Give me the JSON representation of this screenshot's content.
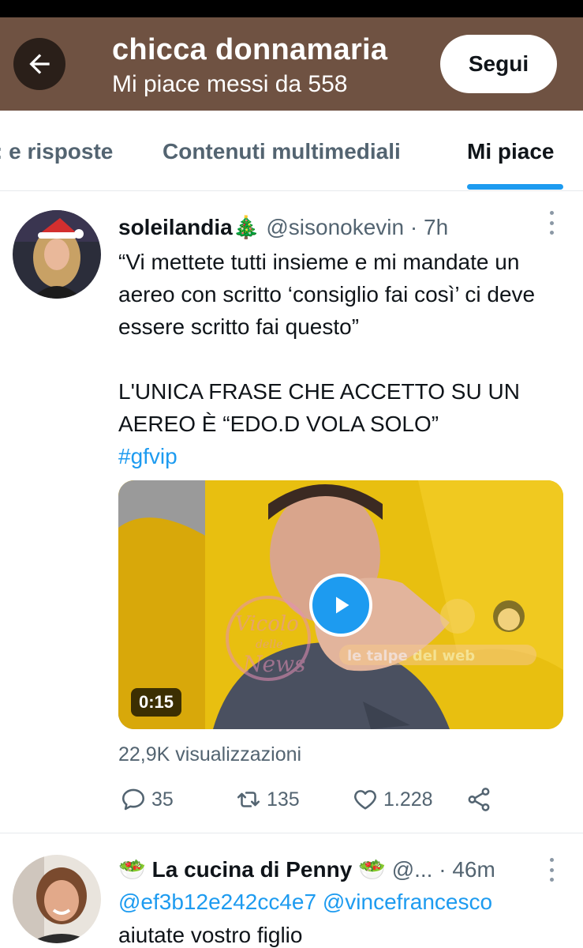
{
  "header": {
    "title": "chicca donnamaria",
    "subtitle": "Mi piace messi da 558",
    "follow_label": "Segui",
    "background": "#6f5242"
  },
  "tabs": [
    {
      "label": ": e risposte"
    },
    {
      "label": "Contenuti multimediali"
    },
    {
      "label": "Mi piace",
      "active": true
    }
  ],
  "accent_color": "#1d9bf0",
  "tweets": [
    {
      "display_name": "soleilandia🎄",
      "handle": "@sisonokevin",
      "separator": "·",
      "time": "7h",
      "text_1": "“Vi mettete tutti insieme e mi mandate un aereo con scritto ‘consiglio fai così’ ci deve essere scritto fai questo”",
      "text_2": "L'UNICA FRASE CHE ACCETTO SU UN AEREO È “EDO.D VOLA SOLO”",
      "hashtag": "#gfvip",
      "video_duration": "0:15",
      "views": "22,9K visualizzazioni",
      "replies": "35",
      "retweets": "135",
      "likes": "1.228",
      "icons": [
        "reply-icon",
        "retweet-icon",
        "heart-icon",
        "share-icon"
      ]
    },
    {
      "display_name": "🥗 La cucina di Penny 🥗",
      "handle": "@...",
      "separator": "·",
      "time": "46m",
      "reply_to": "@ef3b12e242cc4e7 @vincefrancesco",
      "text": "aiutate vostro figlio"
    }
  ]
}
